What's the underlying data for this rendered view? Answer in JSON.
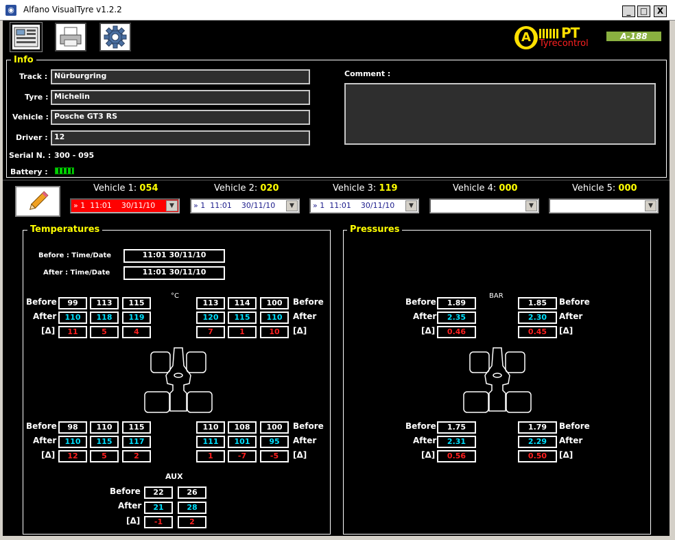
{
  "window": {
    "title": "Alfano VisualTyre v1.2.2",
    "min": "_",
    "max": "□",
    "close": "X"
  },
  "brand": {
    "logo_text": "PT",
    "logo_sub": "Tyrecontrol",
    "model": "A-188"
  },
  "info": {
    "title": "Info",
    "track_label": "Track :",
    "track": "Nürburgring",
    "tyre_label": "Tyre :",
    "tyre": "Michelin",
    "vehicle_label": "Vehicle :",
    "vehicle": "Posche GT3 RS",
    "driver_label": "Driver :",
    "driver": "12",
    "serial_label": "Serial N. :",
    "serial": "300 - 095",
    "battery_label": "Battery :",
    "comment_label": "Comment :",
    "comment": ""
  },
  "vehicles": [
    {
      "label": "Vehicle 1:",
      "num": "054",
      "combo": "» 1  11:01    30/11/10",
      "selected": true
    },
    {
      "label": "Vehicle 2:",
      "num": "020",
      "combo": "» 1  11:01    30/11/10",
      "selected": false
    },
    {
      "label": "Vehicle 3:",
      "num": "119",
      "combo": "» 1  11:01    30/11/10",
      "selected": false
    },
    {
      "label": "Vehicle 4:",
      "num": "000",
      "combo": "",
      "selected": false
    },
    {
      "label": "Vehicle 5:",
      "num": "000",
      "combo": "",
      "selected": false
    }
  ],
  "temps": {
    "title": "Temperatures",
    "before_time_label": "Before : Time/Date",
    "before_time": "11:01    30/11/10",
    "after_time_label": "After : Time/Date",
    "after_time": "11:01    30/11/10",
    "unit": "°C",
    "labels": {
      "before": "Before",
      "after": "After",
      "delta": "[Δ]"
    },
    "fl": {
      "before": [
        "99",
        "113",
        "115"
      ],
      "after": [
        "110",
        "118",
        "119"
      ],
      "delta": [
        "11",
        "5",
        "4"
      ]
    },
    "fr": {
      "before": [
        "113",
        "114",
        "100"
      ],
      "after": [
        "120",
        "115",
        "110"
      ],
      "delta": [
        "7",
        "1",
        "10"
      ]
    },
    "rl": {
      "before": [
        "98",
        "110",
        "115"
      ],
      "after": [
        "110",
        "115",
        "117"
      ],
      "delta": [
        "12",
        "5",
        "2"
      ]
    },
    "rr": {
      "before": [
        "110",
        "108",
        "100"
      ],
      "after": [
        "111",
        "101",
        "95"
      ],
      "delta": [
        "1",
        "-7",
        "-5"
      ]
    },
    "aux_label": "AUX",
    "aux": {
      "before": [
        "22",
        "26"
      ],
      "after": [
        "21",
        "28"
      ],
      "delta": [
        "-1",
        "2"
      ]
    }
  },
  "pressures": {
    "title": "Pressures",
    "unit": "BAR",
    "fl": {
      "before": "1.89",
      "after": "2.35",
      "delta": "0.46"
    },
    "fr": {
      "before": "1.85",
      "after": "2.30",
      "delta": "0.45"
    },
    "rl": {
      "before": "1.75",
      "after": "2.31",
      "delta": "0.56"
    },
    "rr": {
      "before": "1.79",
      "after": "2.29",
      "delta": "0.50"
    }
  }
}
